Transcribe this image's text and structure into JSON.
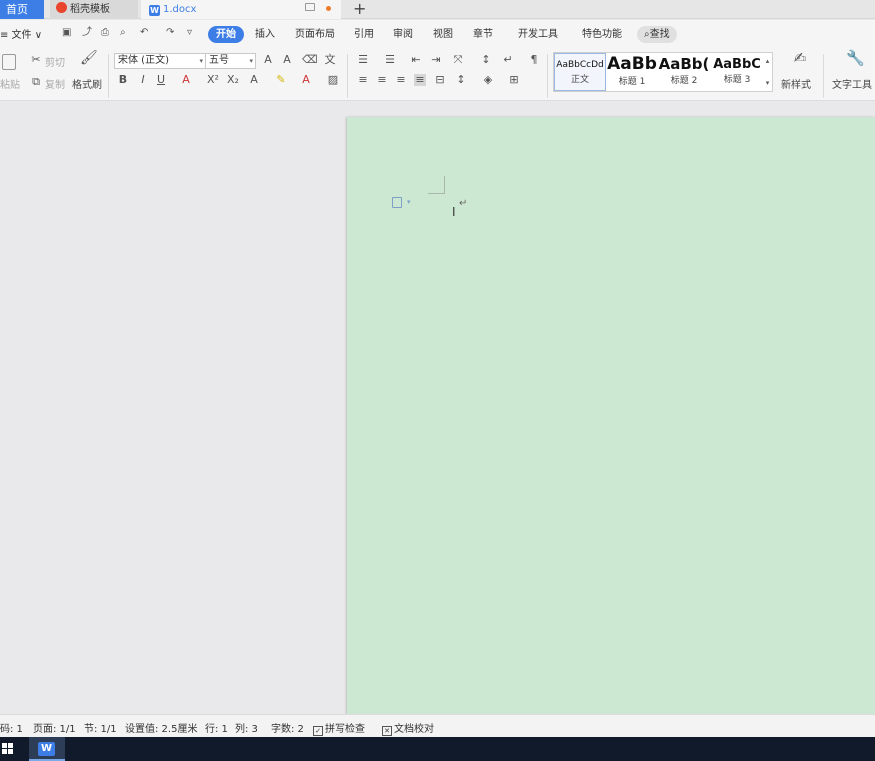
{
  "tabs": {
    "home": "首页",
    "templates": "稻壳模板",
    "document": "1.docx"
  },
  "menu": {
    "file": "≡ 文件 ∨",
    "items": [
      "开始",
      "插入",
      "页面布局",
      "引用",
      "审阅",
      "视图",
      "章节",
      "开发工具",
      "特色功能"
    ],
    "search": "查找"
  },
  "ribbon": {
    "paste": "粘贴",
    "cut": "剪切",
    "copy": "复制",
    "format_painter": "格式刷",
    "font_name": "宋体 (正文)",
    "font_size": "五号",
    "bold": "B",
    "italic": "I",
    "underline": "U",
    "styles": [
      {
        "sample": "AaBbCcDd",
        "name": "正文"
      },
      {
        "sample": "AaBb",
        "name": "标题 1"
      },
      {
        "sample": "AaBb(",
        "name": "标题 2"
      },
      {
        "sample": "AaBbC",
        "name": "标题 3"
      }
    ],
    "new_style": "新样式",
    "text_tools": "文字工具"
  },
  "status": {
    "page_num": "码: 1",
    "pages": "页面: 1/1",
    "section": "节: 1/1",
    "setting": "设置值: 2.5厘米",
    "row": "行: 1",
    "col": "列: 3",
    "word_count": "字数: 2",
    "spell_check": "拼写检查",
    "doc_check": "文档校对"
  },
  "colors": {
    "accent": "#3d7ee6",
    "page_bg": "#cde8d2",
    "workspace_bg": "#e9e8ea",
    "taskbar_bg": "#101a2a"
  }
}
